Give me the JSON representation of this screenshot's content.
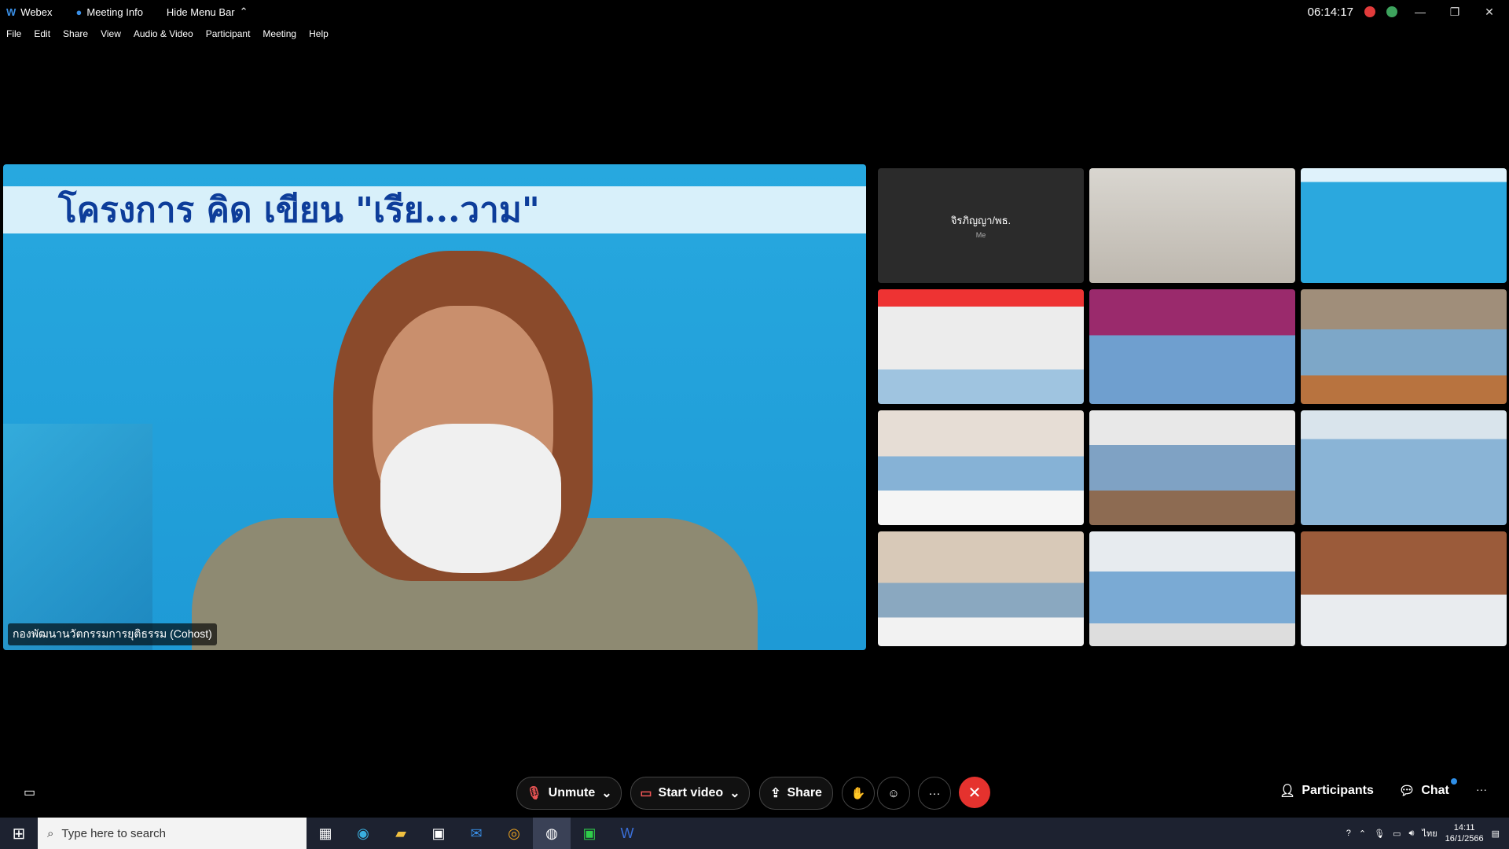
{
  "titlebar": {
    "app": "Webex",
    "meeting_info": "Meeting Info",
    "hide_menu": "Hide Menu Bar",
    "clock": "06:14:17"
  },
  "menubar": [
    "File",
    "Edit",
    "Share",
    "View",
    "Audio & Video",
    "Participant",
    "Meeting",
    "Help"
  ],
  "stage": {
    "banner_text": "โครงการ คิด เขียน \"เรีย...วาม\"",
    "speaker": "กองพัฒนานวัตกรรมการยุติธรรม (Cohost)"
  },
  "self_tile": {
    "name": "จิรภิญญา/พธ.",
    "sub": "Me"
  },
  "controls": {
    "unmute": "Unmute",
    "start_video": "Start video",
    "share": "Share",
    "participants": "Participants",
    "chat": "Chat"
  },
  "taskbar": {
    "search_placeholder": "Type here to search",
    "time": "14:11",
    "date": "16/1/2566",
    "lang": "ไทย"
  },
  "colors": {
    "end_call": "#e5322e",
    "stage": "#27a8df",
    "banner_text": "#0d3d9a"
  }
}
